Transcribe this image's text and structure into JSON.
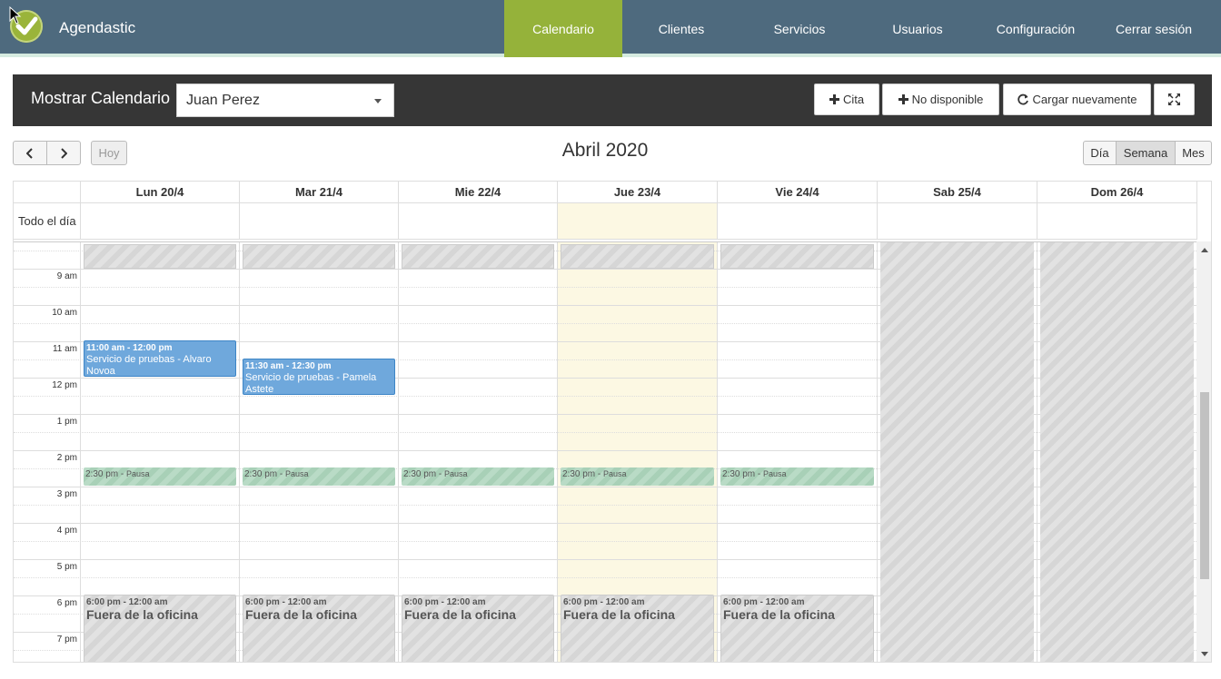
{
  "brand": {
    "name": "Agendastic"
  },
  "nav": {
    "items": [
      {
        "label": "Calendario",
        "active": true
      },
      {
        "label": "Clientes"
      },
      {
        "label": "Servicios"
      },
      {
        "label": "Usuarios"
      },
      {
        "label": "Configuración"
      },
      {
        "label": "Cerrar sesión"
      }
    ]
  },
  "toolbar": {
    "title": "Mostrar Calendario",
    "selected_user": "Juan Perez",
    "buttons": {
      "cita": "Cita",
      "no_disponible": "No disponible",
      "recargar": "Cargar nuevamente"
    }
  },
  "calendar": {
    "title": "Abril 2020",
    "today_label": "Hoy",
    "views": [
      "Día",
      "Semana",
      "Mes"
    ],
    "active_view": "Semana",
    "allday_label": "Todo el día",
    "days": [
      "Lun 20/4",
      "Mar 21/4",
      "Mie 22/4",
      "Jue 23/4",
      "Vie 24/4",
      "Sab 25/4",
      "Dom 26/4"
    ],
    "time_labels": [
      "9 am",
      "10 am",
      "11 am",
      "12 pm",
      "1 pm",
      "2 pm",
      "3 pm",
      "4 pm",
      "5 pm",
      "6 pm",
      "7 pm"
    ],
    "appointments": [
      {
        "day": 0,
        "time": "11:00 am - 12:00 pm",
        "title": "Servicio de pruebas - Alvaro Novoa"
      },
      {
        "day": 1,
        "time": "11:30 am - 12:30 pm",
        "title": "Servicio de pruebas - Pamela Astete"
      }
    ],
    "pause": {
      "time": "2:30 pm",
      "label": "Pausa"
    },
    "out_of_office": {
      "time": "6:00 pm - 12:00 am",
      "label": "Fuera de la oficina"
    }
  },
  "colors": {
    "nav": "#4e6a7e",
    "active_nav": "#95b23a",
    "today": "#fcf8e3",
    "appointment": "#6fa8dc"
  }
}
